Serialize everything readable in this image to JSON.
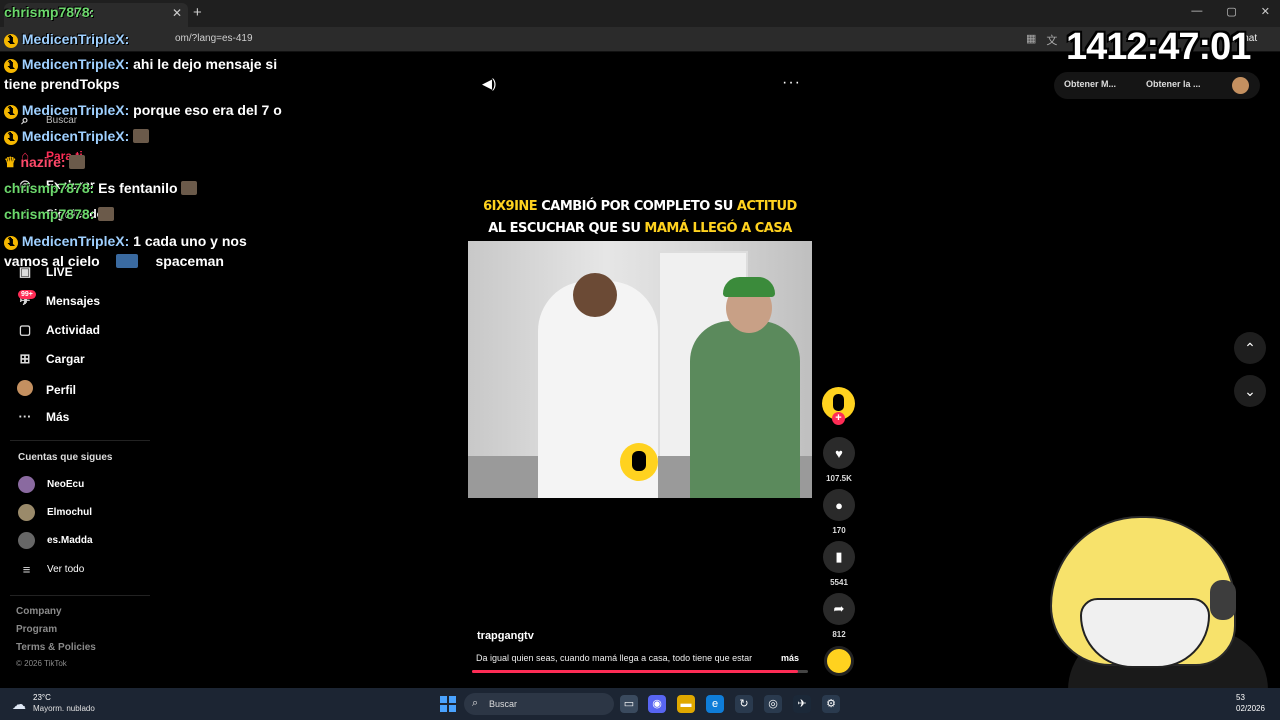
{
  "browser": {
    "tab_title": "Day",
    "url": "om/?lang=es-419",
    "chat_button": "Chat",
    "new_tab": "+",
    "tab_close": "✕",
    "window_controls": [
      "—",
      "▢",
      "✕"
    ]
  },
  "stream": {
    "timer": "1412:47:01"
  },
  "chat": {
    "lines": [
      {
        "user": "chrismp7878:",
        "user_color": "#6cd86c",
        "badges": 0,
        "text": ""
      },
      {
        "user": "MedicenTripleX:",
        "user_color": "#9fd0ff",
        "badges": 2,
        "text": ""
      },
      {
        "user": "MedicenTripleX:",
        "user_color": "#9fd0ff",
        "badges": 2,
        "text": "ahi le dejo mensaje si"
      },
      {
        "user": "",
        "user_color": "#ffffff",
        "badges": 0,
        "text": "tiene prendTokps"
      },
      {
        "user": "MedicenTripleX:",
        "user_color": "#9fd0ff",
        "badges": 2,
        "text": "porque eso era del 7 o"
      },
      {
        "user": "MedicenTripleX:",
        "user_color": "#9fd0ff",
        "badges": 2,
        "text": ""
      },
      {
        "user": "nazire:",
        "user_color": "#ff4a6a",
        "badges": 1,
        "text": ""
      },
      {
        "user": "chrismp7878:",
        "user_color": "#6cd86c",
        "badges": 0,
        "text": "Es fentanilo"
      },
      {
        "user": "chrismp7878:",
        "user_color": "#6cd86c",
        "badges": 0,
        "text": ""
      },
      {
        "user": "MedicenTripleX:",
        "user_color": "#9fd0ff",
        "badges": 2,
        "text": "1 cada uno y nos"
      },
      {
        "user": "",
        "user_color": "#ffffff",
        "badges": 0,
        "text": "vamos al cielo"
      },
      {
        "user": "",
        "user_color": "#ffffff",
        "badges": 0,
        "text": "spaceman"
      }
    ]
  },
  "sidebar": {
    "search_placeholder": "Buscar",
    "items": [
      {
        "label": "Para ti",
        "icon": "home-icon"
      },
      {
        "label": "Explorar",
        "icon": "compass-icon"
      },
      {
        "label": "Siguiendo",
        "icon": "following-icon"
      },
      {
        "label": "LIVE",
        "icon": "live-icon"
      },
      {
        "label": "Mensajes",
        "icon": "messages-icon"
      },
      {
        "label": "Actividad",
        "icon": "activity-icon"
      },
      {
        "label": "Cargar",
        "icon": "upload-icon"
      },
      {
        "label": "Perfil",
        "icon": "profile-icon"
      },
      {
        "label": "Más",
        "icon": "more-icon"
      }
    ],
    "messages_badge": "99+",
    "following_title": "Cuentas que sigues",
    "following": [
      {
        "name": "NeoEcu"
      },
      {
        "name": "Elmochul"
      },
      {
        "name": "es.Madda"
      }
    ],
    "see_all": "Ver todo",
    "footer_links": [
      "Company",
      "Program",
      "Terms & Policies"
    ],
    "copyright": "© 2026 TikTok"
  },
  "video": {
    "caption_line1_a": "6IX9INE",
    "caption_line1_b": " CAMBIÓ POR COMPLETO SU ",
    "caption_line1_c": "ACTITUD",
    "caption_line2_a": "AL ESCUCHAR QUE SU ",
    "caption_line2_b": "MAMÁ LLEGÓ A CASA",
    "author": "trapgangtv",
    "description": "Da igual quien seas, cuando mamá llega a casa, todo tiene que estar",
    "more_link": "más",
    "progress": 0.97,
    "likes": "107.5K",
    "comments": "170",
    "saves": "5541",
    "shares": "812",
    "follow_plus": "+"
  },
  "top_right": {
    "get_m": "Obtener M...",
    "get_la": "Obtener la ..."
  },
  "taskbar": {
    "temp": "23°C",
    "weather": "Mayorm. nublado",
    "search": "Buscar",
    "time": "53",
    "date": "02/2026"
  },
  "colors": {
    "accent": "#fe2c55",
    "highlight": "#ffd21f"
  }
}
